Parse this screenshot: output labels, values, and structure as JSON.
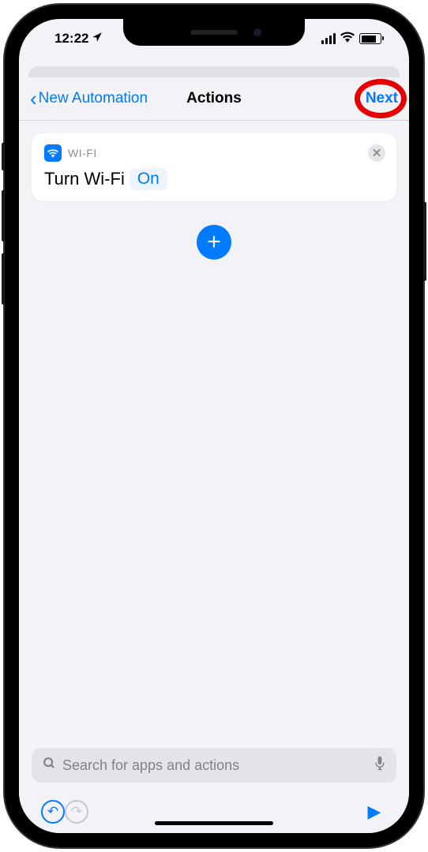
{
  "status": {
    "time": "12:22",
    "location_indicator": "➤"
  },
  "nav": {
    "back_label": "New Automation",
    "title": "Actions",
    "next_label": "Next"
  },
  "action": {
    "category": "WI-FI",
    "action_text": "Turn Wi-Fi",
    "param_value": "On"
  },
  "search": {
    "placeholder": "Search for apps and actions"
  }
}
